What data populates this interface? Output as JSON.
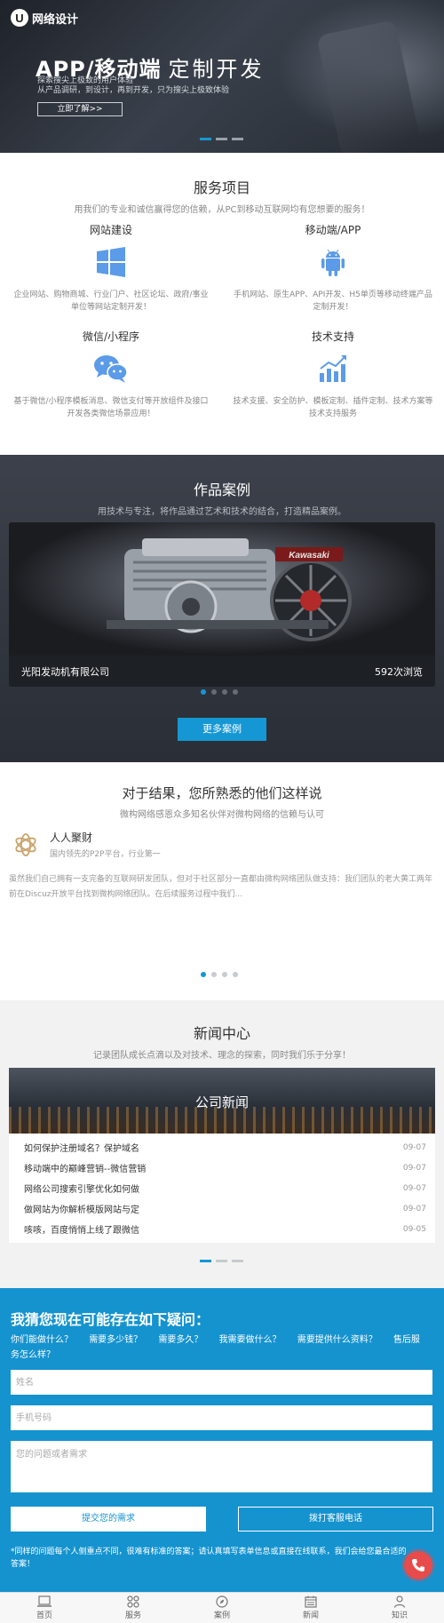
{
  "brand": {
    "logo_mark": "U",
    "name": "网络设计"
  },
  "hero": {
    "title_bold": "APP/移动端",
    "title_thin": "定制开发",
    "sub_line1": "探索搜尖上极致的用户体验",
    "sub_line2": "从产品调研，到设计，再到开发，只为搜尖上极致体验",
    "button_label": "立即了解>>"
  },
  "services": {
    "title": "服务项目",
    "subtitle": "用我们的专业和诚信赢得您的信赖，从PC到移动互联网均有您想要的服务！",
    "items": [
      {
        "name": "网站建设",
        "icon": "windows-icon",
        "desc": "企业网站、购物商城、行业门户、社区论坛、政府/事业单位等网站定制开发！"
      },
      {
        "name": "移动端/APP",
        "icon": "android-icon",
        "desc": "手机网站、原生APP、API开发、H5单页等移动终端产品定制开发！"
      },
      {
        "name": "微信/小程序",
        "icon": "wechat-icon",
        "desc": "基于微信/小程序模板消息、微信支付等开放组件及接口开发各类微信场景应用！"
      },
      {
        "name": "技术支持",
        "icon": "chart-icon",
        "desc": "技术支援、安全防护、模板定制、插件定制、技术方案等技术支持服务"
      }
    ]
  },
  "cases": {
    "title": "作品案例",
    "subtitle": "用技术与专注，将作品通过艺术和技术的结合，打造精品案例。",
    "card_company": "光阳发动机有限公司",
    "card_views": "592次浏览",
    "engine_label": "Kawasaki",
    "more_label": "更多案例"
  },
  "testimonial": {
    "title": "对于结果，您所熟悉的他们这样说",
    "subtitle": "微构网络感恩众多知名伙伴对微构网络的信赖与认可",
    "client_name": "人人聚财",
    "client_sub": "国内领先的P2P平台，行业第一",
    "quote": "虽然我们自己拥有一支完备的互联网研发团队，但对于社区部分一直都由微构网络团队做支持：我们团队的老大黄工两年前在Discuz开放平台找到微构网络团队。在后续服务过程中我们..."
  },
  "news": {
    "title": "新闻中心",
    "subtitle": "记录团队成长点滴以及对技术、理念的探索，同时我们乐于分享！",
    "banner_title": "公司新闻",
    "items": [
      {
        "title": "如何保护注册域名？保护域名",
        "date": "09-07"
      },
      {
        "title": "移动端中的巅峰营销--微信营销",
        "date": "09-07"
      },
      {
        "title": "网络公司搜索引擎优化如何做",
        "date": "09-07"
      },
      {
        "title": "做网站为你解析模版网站与定",
        "date": "09-07"
      },
      {
        "title": "咳咳，百度悄悄上线了跟微信",
        "date": "09-05"
      }
    ]
  },
  "contact": {
    "title": "我猜您现在可能存在如下疑问：",
    "questions": [
      "你们能做什么？",
      "需要多少钱？",
      "需要多久？",
      "我需要做什么？",
      "需要提供什么资料？",
      "售后服务怎么样？"
    ],
    "name_placeholder": "姓名",
    "phone_placeholder": "手机号码",
    "message_placeholder": "您的问题或者需求",
    "submit_label": "提交您的需求",
    "call_label": "拨打客服电话",
    "note": "*同样的问题每个人侧重点不同，很难有标准的答案；请认真填写表单信息或直接在线联系，我们会给您最合适的答案！"
  },
  "bottom_nav": [
    {
      "label": "首页",
      "icon": "laptop-icon"
    },
    {
      "label": "服务",
      "icon": "grid-icon"
    },
    {
      "label": "案例",
      "icon": "compass-icon"
    },
    {
      "label": "新闻",
      "icon": "calendar-icon"
    },
    {
      "label": "知识",
      "icon": "user-icon"
    }
  ],
  "colors": {
    "accent": "#1597d4",
    "contact_bg": "#1593cf",
    "fab": "#e84b4b",
    "icon_blue": "#5b9be8"
  }
}
